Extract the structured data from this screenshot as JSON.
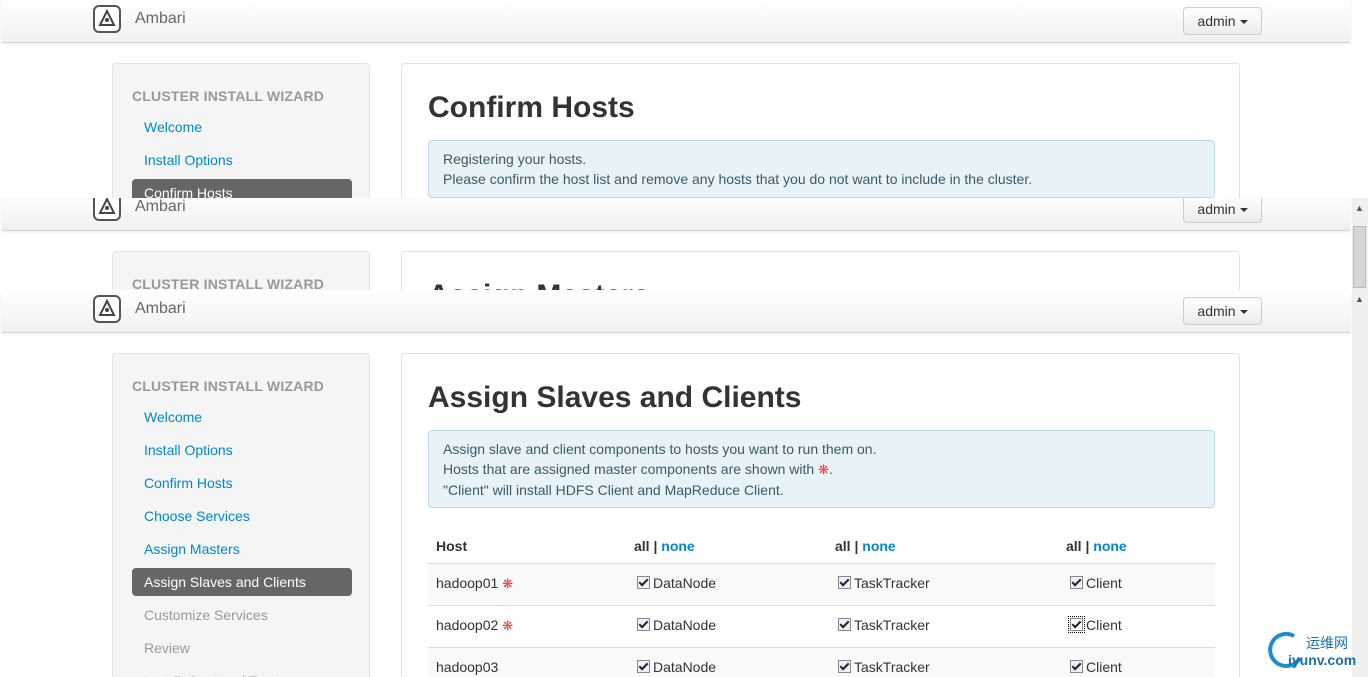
{
  "brand": {
    "name": "Ambari"
  },
  "user_menu": {
    "label": "admin"
  },
  "panel1": {
    "sidebar": {
      "title": "CLUSTER INSTALL WIZARD",
      "items": [
        {
          "label": "Welcome",
          "state": "link"
        },
        {
          "label": "Install Options",
          "state": "link"
        },
        {
          "label": "Confirm Hosts",
          "state": "active"
        }
      ]
    },
    "title": "Confirm Hosts",
    "alert": [
      "Registering your hosts.",
      "Please confirm the host list and remove any hosts that you do not want to include in the cluster."
    ]
  },
  "panel2": {
    "sidebar": {
      "title": "CLUSTER INSTALL WIZARD"
    },
    "title": "Assign Masters"
  },
  "panel3": {
    "sidebar": {
      "title": "CLUSTER INSTALL WIZARD",
      "items": [
        {
          "label": "Welcome",
          "state": "link"
        },
        {
          "label": "Install Options",
          "state": "link"
        },
        {
          "label": "Confirm Hosts",
          "state": "link"
        },
        {
          "label": "Choose Services",
          "state": "link"
        },
        {
          "label": "Assign Masters",
          "state": "link"
        },
        {
          "label": "Assign Slaves and Clients",
          "state": "active"
        },
        {
          "label": "Customize Services",
          "state": "disabled"
        },
        {
          "label": "Review",
          "state": "disabled"
        },
        {
          "label": "Install, Start and Test",
          "state": "disabled"
        }
      ]
    },
    "title": "Assign Slaves and Clients",
    "alert": {
      "line1": "Assign slave and client components to hosts you want to run them on.",
      "line2_prefix": "Hosts that are assigned master components are shown with ",
      "line2_suffix": ".",
      "line3": "\"Client\" will install HDFS Client and MapReduce Client."
    },
    "table": {
      "host_header": "Host",
      "all_label": "all",
      "separator": "|",
      "none_label": "none",
      "component_labels": [
        "DataNode",
        "TaskTracker",
        "Client"
      ],
      "rows": [
        {
          "host": "hadoop01",
          "master": true,
          "checked": [
            true,
            true,
            true
          ]
        },
        {
          "host": "hadoop02",
          "master": true,
          "checked": [
            true,
            true,
            true
          ]
        },
        {
          "host": "hadoop03",
          "master": false,
          "checked": [
            true,
            true,
            true
          ]
        }
      ]
    }
  },
  "watermark": {
    "text1": "运维网",
    "text2": "iyunv.com"
  },
  "colors": {
    "link": "#0088cc",
    "active_nav": "#666666",
    "alert_bg": "#e8f3f7",
    "master_star": "#e0403a"
  },
  "icons": {
    "brand": "ambari-logo-icon",
    "caret": "caret-down-icon",
    "master": "asterisk-icon",
    "checkbox": "checkbox-checked-icon"
  }
}
